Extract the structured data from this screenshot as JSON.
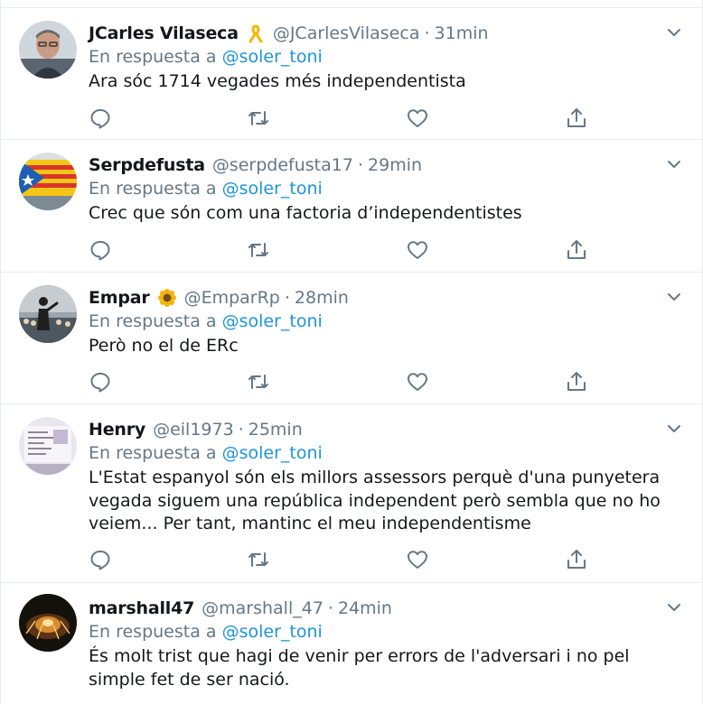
{
  "colors": {
    "text": "#14171a",
    "secondary": "#657786",
    "link": "#1b95e0",
    "border": "#e6ecf0"
  },
  "reply_prefix": "En respuesta a",
  "tweets": [
    {
      "name": "JCarles Vilaseca",
      "emoji": "yellow-ribbon",
      "handle": "@JCarlesVilaseca",
      "time": "31min",
      "reply_to": "@soler_toni",
      "text": "Ara sóc 1714 vegades més independentista"
    },
    {
      "name": "Serpdefusta",
      "handle": "@serpdefusta17",
      "time": "29min",
      "reply_to": "@soler_toni",
      "text": "Crec que són com una factoria d’independentistes"
    },
    {
      "name": "Empar",
      "emoji": "sunflower",
      "handle": "@EmparRp",
      "time": "28min",
      "reply_to": "@soler_toni",
      "text": "Però no el de ERc"
    },
    {
      "name": "Henry",
      "handle": "@eil1973",
      "time": "25min",
      "reply_to": "@soler_toni",
      "text": "L'Estat espanyol són els millors assessors perquè d'una punyetera vegada siguem una república independent però sembla que no ho veiem... Per tant, mantinc el meu independentisme"
    },
    {
      "name": "marshall47",
      "handle": "@marshall_47",
      "time": "24min",
      "reply_to": "@soler_toni",
      "text": "És molt trist que hagi de venir per errors de l'adversari i no pel simple fet de ser nació."
    }
  ]
}
